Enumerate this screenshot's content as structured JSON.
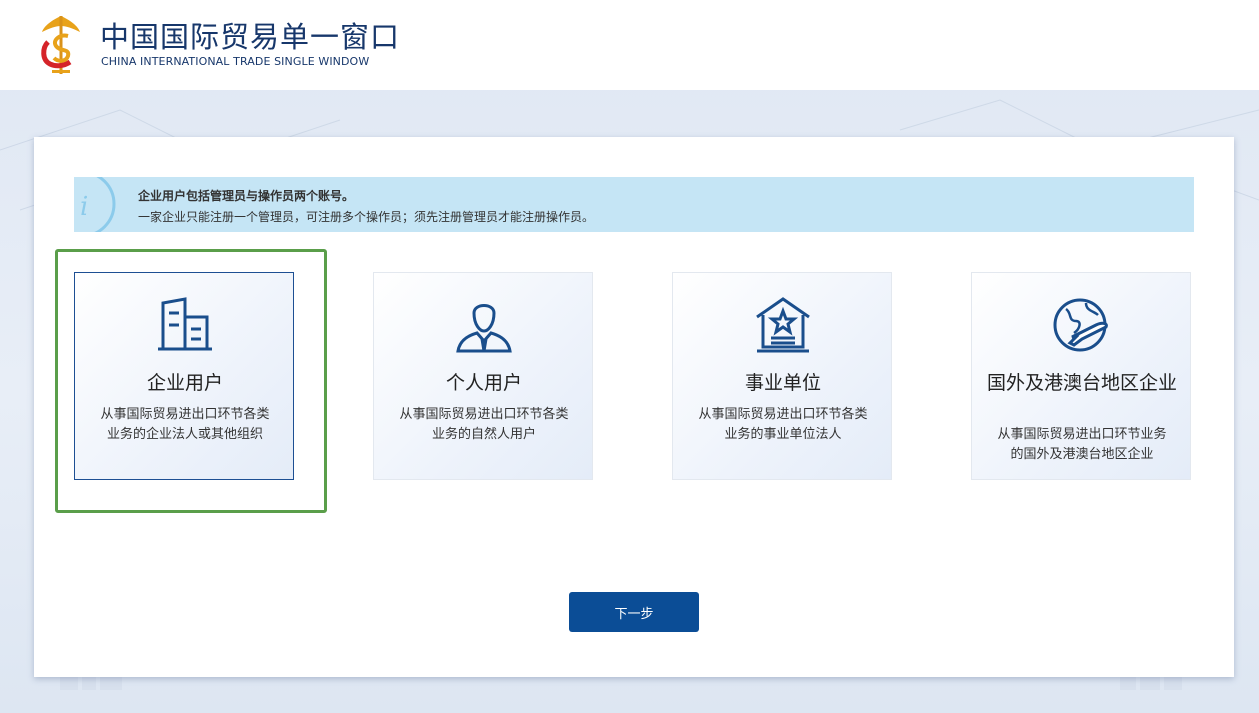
{
  "header": {
    "title_cn": "中国国际贸易单一窗口",
    "title_en": "CHINA INTERNATIONAL TRADE SINGLE WINDOW"
  },
  "notice": {
    "icon": "info-icon",
    "line1": "企业用户包括管理员与操作员两个账号。",
    "line2": "一家企业只能注册一个管理员，可注册多个操作员；须先注册管理员才能注册操作员。"
  },
  "cards": [
    {
      "title": "企业用户",
      "desc": "从事国际贸易进出口环节各类业务的企业法人或其他组织",
      "icon": "building-icon",
      "selected": true
    },
    {
      "title": "个人用户",
      "desc": "从事国际贸易进出口环节各类业务的自然人用户",
      "icon": "person-icon",
      "selected": false
    },
    {
      "title": "事业单位",
      "desc": "从事国际贸易进出口环节各类业务的事业单位法人",
      "icon": "institution-icon",
      "selected": false
    },
    {
      "title": "国外及港澳台地区企业",
      "desc": "从事国际贸易进出口环节业务的国外及港澳台地区企业",
      "icon": "globe-plane-icon",
      "selected": false
    }
  ],
  "next_label": "下一步",
  "colors": {
    "brand": "#17376b",
    "accent": "#0b4d96",
    "notice_bg": "#c5e5f5",
    "selection_outline": "#5a9e4a"
  }
}
